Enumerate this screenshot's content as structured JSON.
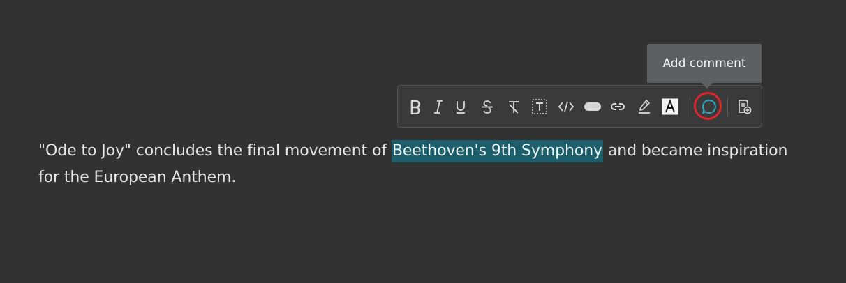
{
  "document": {
    "text_before": "\"Ode to Joy\" concludes the final movement of ",
    "selected_text": "Beethoven's 9th Symphony",
    "text_after": " and became inspiration for the European Anthem."
  },
  "toolbar": {
    "buttons": [
      {
        "name": "bold-button",
        "icon": "bold-icon"
      },
      {
        "name": "italic-button",
        "icon": "italic-icon"
      },
      {
        "name": "underline-button",
        "icon": "underline-icon"
      },
      {
        "name": "strikethrough-button",
        "icon": "strikethrough-icon"
      },
      {
        "name": "clear-formatting-button",
        "icon": "clear-formatting-icon"
      },
      {
        "name": "text-box-button",
        "icon": "text-box-icon"
      },
      {
        "name": "code-button",
        "icon": "code-icon"
      },
      {
        "name": "inline-button",
        "icon": "pill-icon"
      },
      {
        "name": "link-button",
        "icon": "link-icon"
      },
      {
        "name": "highlight-button",
        "icon": "highlighter-icon"
      },
      {
        "name": "font-color-button",
        "icon": "font-color-icon"
      },
      {
        "name": "add-comment-button",
        "icon": "comment-icon"
      },
      {
        "name": "add-note-button",
        "icon": "note-add-icon"
      }
    ]
  },
  "tooltip": {
    "text": "Add comment"
  },
  "colors": {
    "background": "#323232",
    "selection": "#1c5e6b",
    "comment_icon": "#2fa8bd",
    "focus_ring": "#e0242f",
    "tooltip_bg": "#5d6063"
  }
}
